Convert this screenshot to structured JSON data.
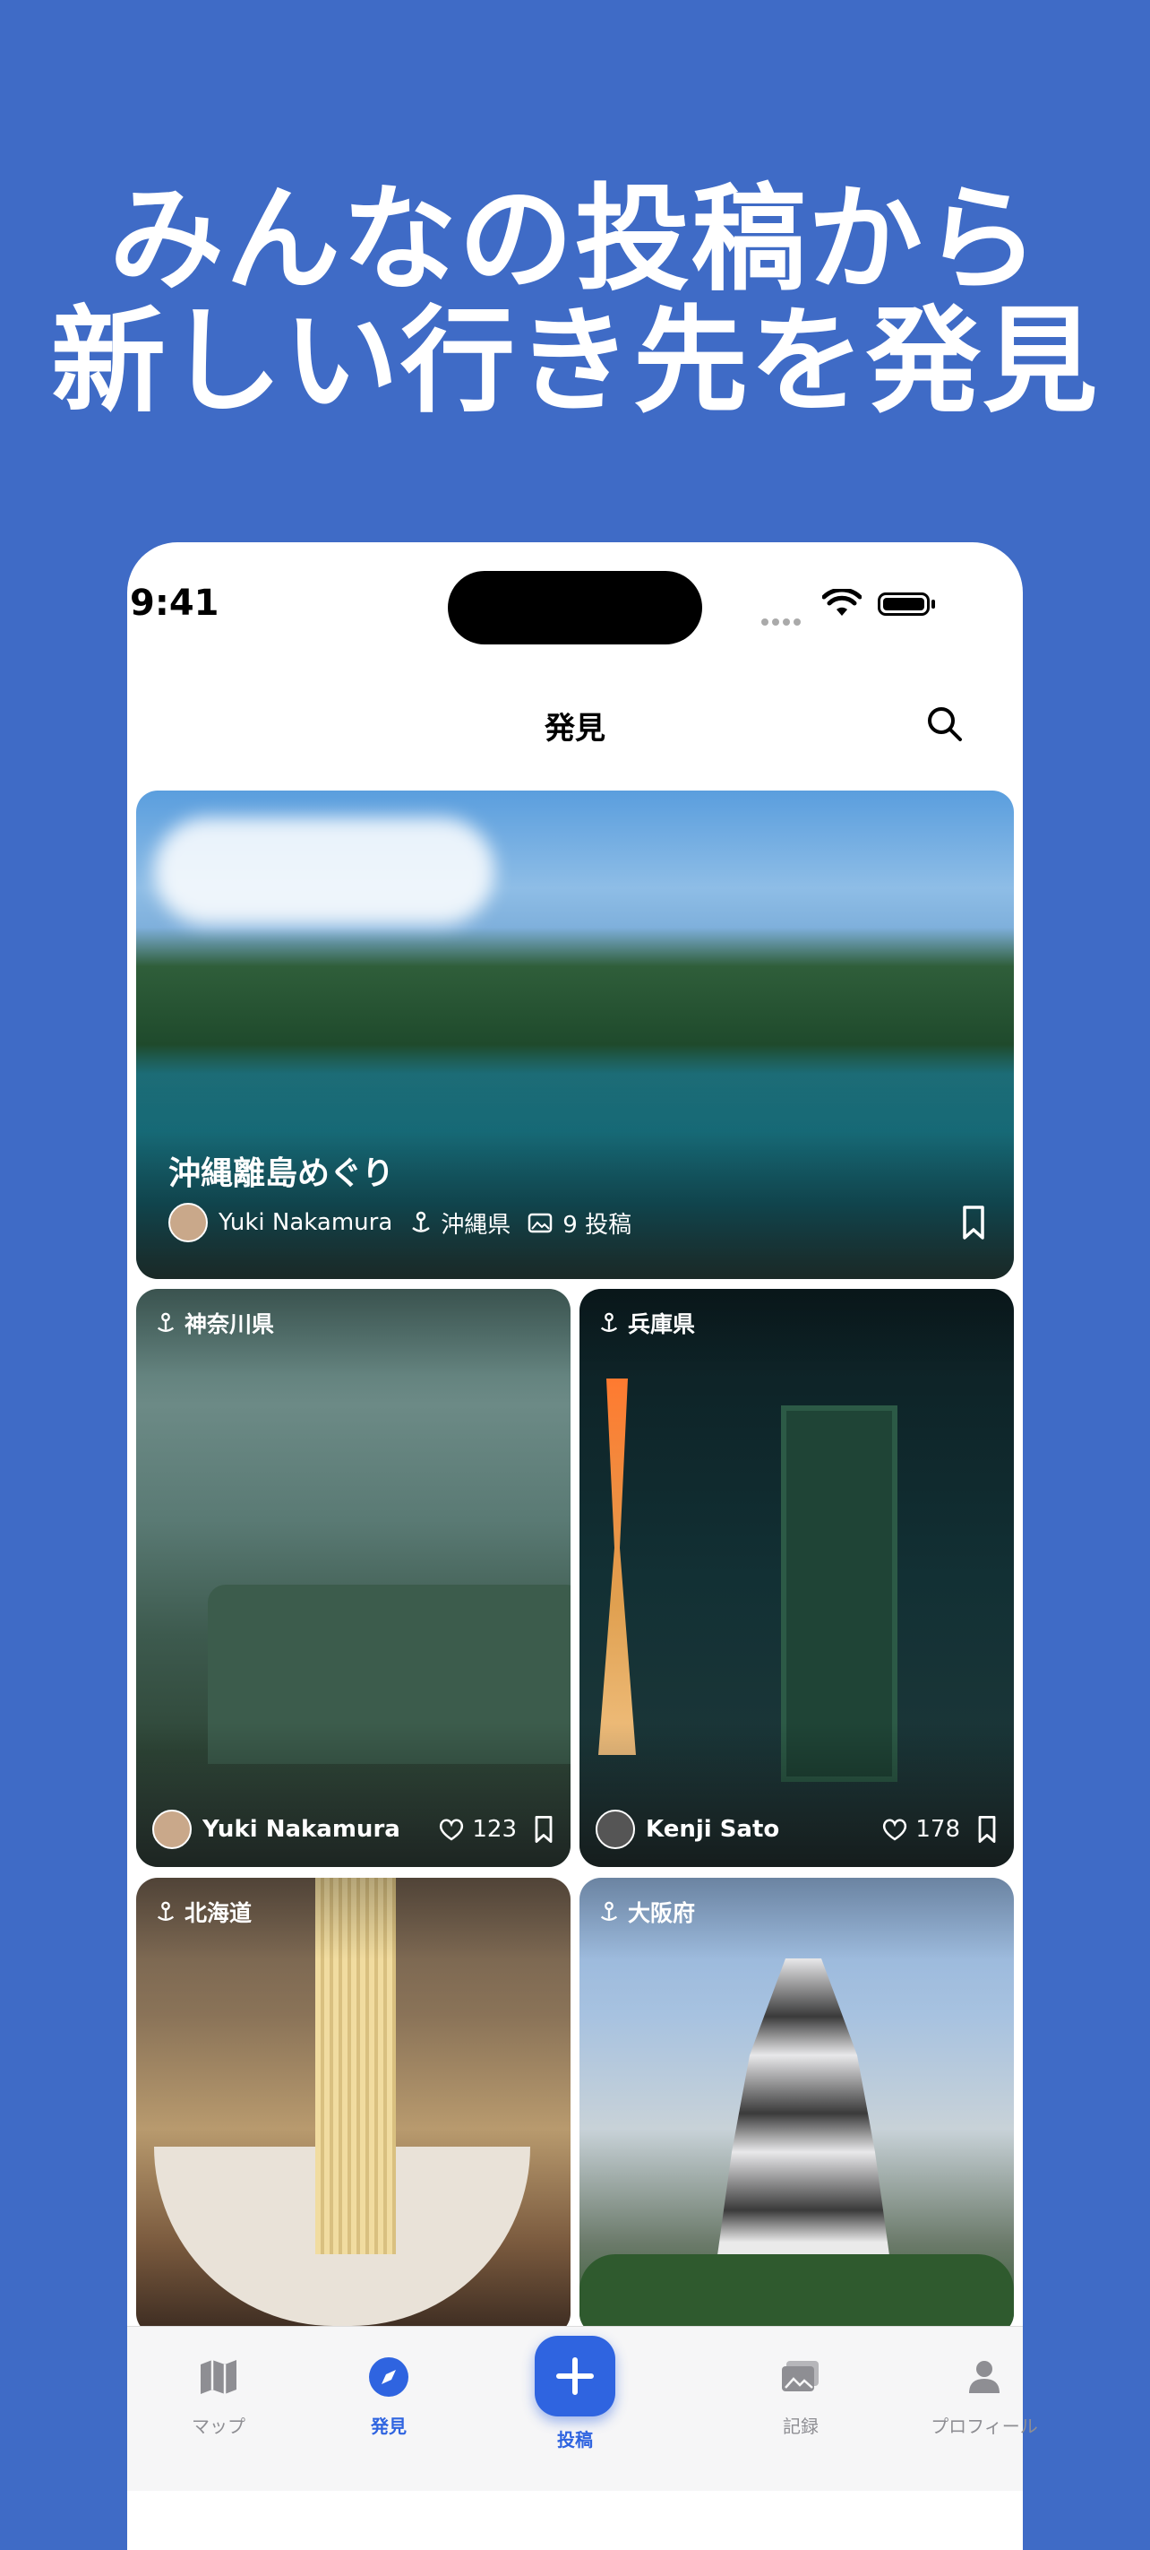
{
  "headline": {
    "line1": "みんなの投稿から",
    "line2": "新しい行き先を発見"
  },
  "status_bar": {
    "time": "9:41"
  },
  "nav": {
    "title": "発見"
  },
  "featured": {
    "title": "沖縄離島めぐり",
    "author": "Yuki Nakamura",
    "prefecture": "沖縄県",
    "post_count": "9 投稿"
  },
  "grid": [
    {
      "prefecture": "神奈川県",
      "author": "Yuki Nakamura",
      "likes": "123"
    },
    {
      "prefecture": "兵庫県",
      "author": "Kenji Sato",
      "likes": "178"
    },
    {
      "prefecture": "北海道"
    },
    {
      "prefecture": "大阪府"
    }
  ],
  "tabbar": {
    "tabs": [
      "マップ",
      "発見",
      "投稿",
      "記録",
      "プロフィール"
    ],
    "active": "発見",
    "accent": "#2f64e0"
  }
}
